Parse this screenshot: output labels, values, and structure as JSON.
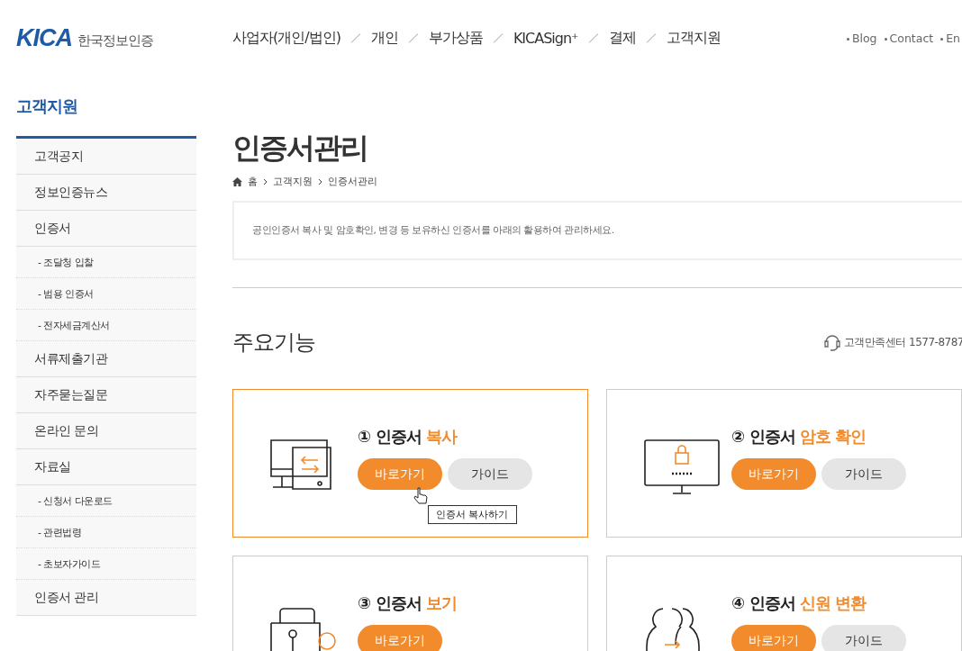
{
  "header": {
    "logo": {
      "mark": "KICA",
      "name": "한국정보인증"
    },
    "nav": [
      "사업자(개인/법인)",
      "개인",
      "부가상품",
      "KICASign⁺",
      "결제",
      "고객지원"
    ],
    "links": [
      "Blog",
      "Contact",
      "En"
    ]
  },
  "sidebar": {
    "title": "고객지원",
    "items": [
      {
        "label": "고객공지",
        "kind": "main"
      },
      {
        "label": "정보인증뉴스",
        "kind": "main"
      },
      {
        "label": "인증서",
        "kind": "main"
      },
      {
        "label": "- 조달청 입찰",
        "kind": "sub"
      },
      {
        "label": "- 범용 인증서",
        "kind": "sub"
      },
      {
        "label": "- 전자세금계산서",
        "kind": "sub"
      },
      {
        "label": "서류제출기관",
        "kind": "main"
      },
      {
        "label": "자주묻는질문",
        "kind": "main"
      },
      {
        "label": "온라인 문의",
        "kind": "main"
      },
      {
        "label": "자료실",
        "kind": "main"
      },
      {
        "label": "- 신청서 다운로드",
        "kind": "sub"
      },
      {
        "label": "- 관련법령",
        "kind": "sub"
      },
      {
        "label": "- 초보자가이드",
        "kind": "sub"
      },
      {
        "label": "인증서 관리",
        "kind": "main"
      }
    ]
  },
  "page": {
    "title": "인증서관리",
    "breadcrumb": [
      "홈",
      "고객지원",
      "인증서관리"
    ],
    "notice": "공인인증서 복사 및 암호확인, 변경 등 보유하신 인증서를 아래의 활용하여 관리하세요.",
    "section_title": "주요기능",
    "support": "고객만족센터 1577-8787"
  },
  "cards": [
    {
      "kind": "copy",
      "title": "① 인증서 **복사**",
      "selected": true,
      "buttons": [
        "바로가기",
        "가이드"
      ],
      "tooltip": "인증서 복사하기"
    },
    {
      "kind": "password",
      "title": "② 인증서 **암호 확인**",
      "selected": false,
      "buttons": [
        "바로가기",
        "가이드"
      ]
    },
    {
      "kind": "view",
      "title": "③ 인증서 **보기**",
      "selected": false,
      "buttons": [
        "바로가기"
      ]
    },
    {
      "kind": "identity",
      "title": "④ 인증서 **신원 변환**",
      "selected": false,
      "buttons": [
        "바로가기",
        "가이드"
      ]
    }
  ]
}
